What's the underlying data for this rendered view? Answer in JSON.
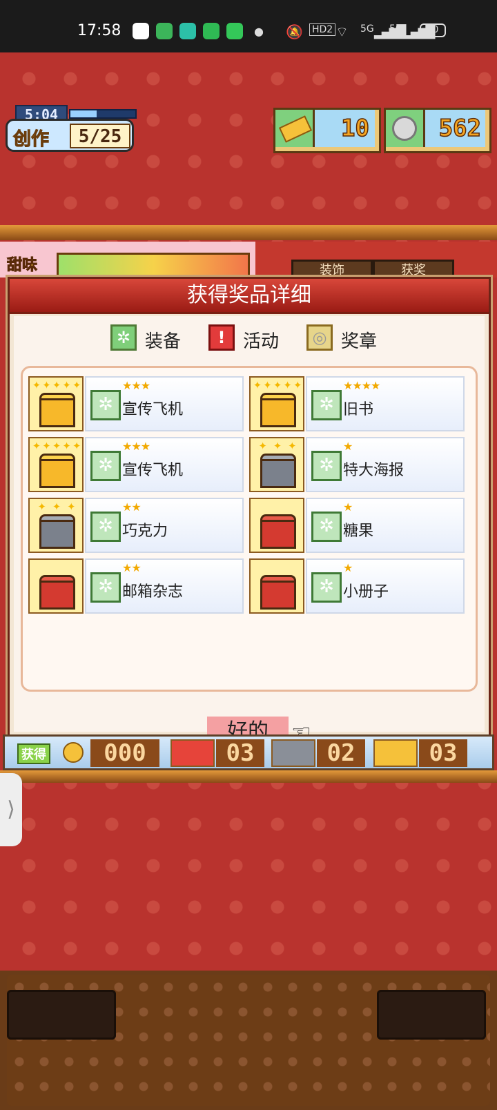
{
  "status_bar": {
    "time": "17:58",
    "right_labels": [
      "HD2",
      "5G",
      "5G"
    ],
    "battery": "60"
  },
  "hud": {
    "create_timer": "5:04",
    "create_label": "创作",
    "create_progress": "5/25",
    "ticket_count": "10",
    "medal_count": "562"
  },
  "behind_panel": {
    "label": "甜味",
    "tabs": [
      "装饰",
      "获奖"
    ]
  },
  "modal": {
    "title": "获得奖品详细",
    "legend": [
      {
        "icon": "gear-icon",
        "label": "装备",
        "color": "#7fcf7a"
      },
      {
        "icon": "exclamation-icon",
        "label": "活动",
        "color": "#e23b3b"
      },
      {
        "icon": "medal-icon",
        "label": "奖章",
        "color": "#e7d58a"
      }
    ],
    "items": [
      {
        "name": "宣传飞机",
        "stars": "★★★",
        "chest": "gold",
        "sparkles": "✦✦✦✦✦"
      },
      {
        "name": "旧书",
        "stars": "★★★★",
        "chest": "gold",
        "sparkles": "✦✦✦✦✦"
      },
      {
        "name": "宣传飞机",
        "stars": "★★★",
        "chest": "gold",
        "sparkles": "✦✦✦✦✦"
      },
      {
        "name": "特大海报",
        "stars": "★",
        "chest": "silver",
        "sparkles": "✦ ✦ ✦"
      },
      {
        "name": "巧克力",
        "stars": "★★",
        "chest": "silver",
        "sparkles": "✦ ✦ ✦"
      },
      {
        "name": "糖果",
        "stars": "★",
        "chest": "red",
        "sparkles": ""
      },
      {
        "name": "邮箱杂志",
        "stars": "★★",
        "chest": "red",
        "sparkles": ""
      },
      {
        "name": "小册子",
        "stars": "★",
        "chest": "red",
        "sparkles": ""
      }
    ],
    "ok_label": "好的"
  },
  "counter_bar": {
    "label": "获得",
    "coin_count": "000",
    "red_chest_count": "03",
    "silver_chest_count": "02",
    "gold_chest_count": "03"
  },
  "side_handle": "⟩"
}
